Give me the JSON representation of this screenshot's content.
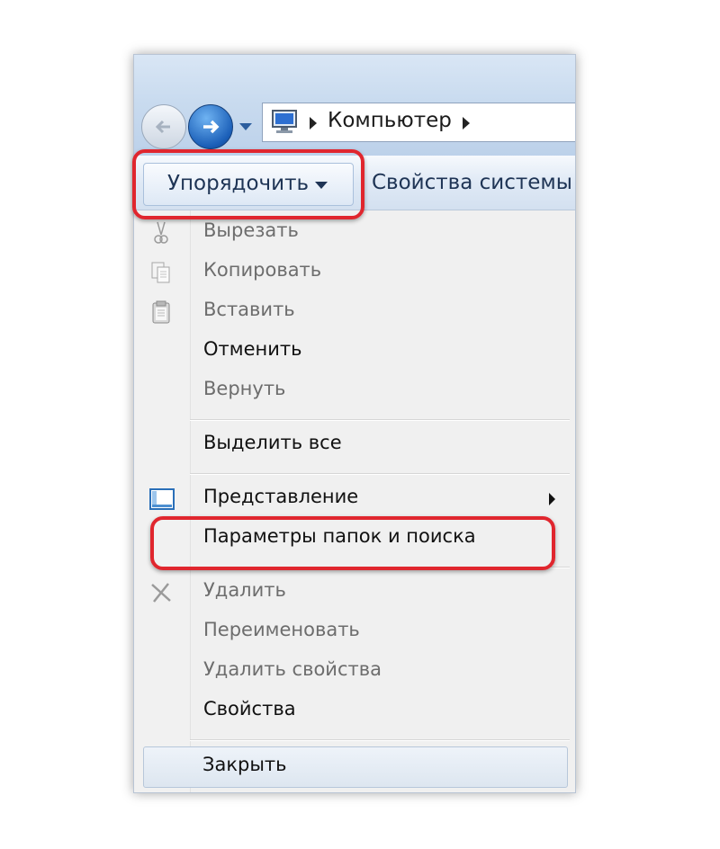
{
  "address": {
    "location": "Компьютер",
    "pc_icon": "computer-icon"
  },
  "toolbar": {
    "organize_label": "Упорядочить",
    "system_properties_label": "Свойства системы"
  },
  "menu": {
    "cut": "Вырезать",
    "copy": "Копировать",
    "paste": "Вставить",
    "undo": "Отменить",
    "redo": "Вернуть",
    "select_all": "Выделить все",
    "view": "Представление",
    "folder_options": "Параметры папок и поиска",
    "delete": "Удалить",
    "rename": "Переименовать",
    "remove_properties": "Удалить свойства",
    "properties": "Свойства",
    "close": "Закрыть"
  },
  "colors": {
    "highlight": "#e0262e",
    "disabled_text": "#6d6d6d",
    "enabled_text": "#111111"
  }
}
